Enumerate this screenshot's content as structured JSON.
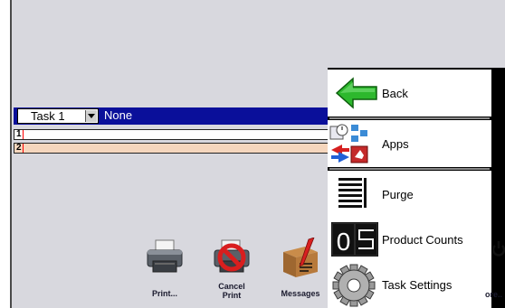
{
  "task": {
    "selected": "Task 1",
    "name": "None"
  },
  "rows": [
    {
      "number": "1"
    },
    {
      "number": "2"
    }
  ],
  "toolbar": {
    "print_label": "Print...",
    "cancel_print_label_line1": "Cancel",
    "cancel_print_label_line2": "Print",
    "messages_label": "Messages",
    "more_label": "ore.."
  },
  "menu": {
    "items": [
      {
        "label": "Back",
        "icon": "back-arrow-icon"
      },
      {
        "label": "Apps",
        "icon": "apps-icon"
      },
      {
        "label": "Purge",
        "icon": "purge-icon"
      },
      {
        "label": "Product Counts",
        "icon": "counter-icon"
      },
      {
        "label": "Task Settings",
        "icon": "gear-icon"
      }
    ]
  },
  "colors": {
    "task_bar": "#0a0f9a",
    "row2_bg": "#f5d6bd",
    "screen_bg": "#d8d8de",
    "back_arrow": "#2db82d"
  }
}
